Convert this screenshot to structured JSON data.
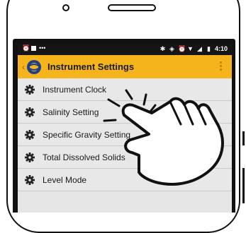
{
  "status_bar": {
    "left_icons": [
      "alarm-icon",
      "notification-icon",
      "more-notifications-icon"
    ],
    "right_icons": [
      "bluetooth-icon",
      "vibrate-icon",
      "alarm-icon",
      "wifi-icon",
      "signal-icon",
      "battery-icon"
    ],
    "time": "4:10"
  },
  "app_bar": {
    "title": "Instrument Settings"
  },
  "menu": {
    "items": [
      {
        "label": "Instrument Clock",
        "icon": "gear-icon"
      },
      {
        "label": "Salinity Setting",
        "icon": "gear-icon"
      },
      {
        "label": "Specific Gravity Setting",
        "icon": "gear-icon"
      },
      {
        "label": "Total Dissolved Solids",
        "icon": "gear-icon"
      },
      {
        "label": "Level Mode",
        "icon": "gear-icon"
      }
    ]
  },
  "colors": {
    "app_bar": "#f5b41c",
    "status_bar": "#151515",
    "list_background": "#e8e8e8"
  }
}
